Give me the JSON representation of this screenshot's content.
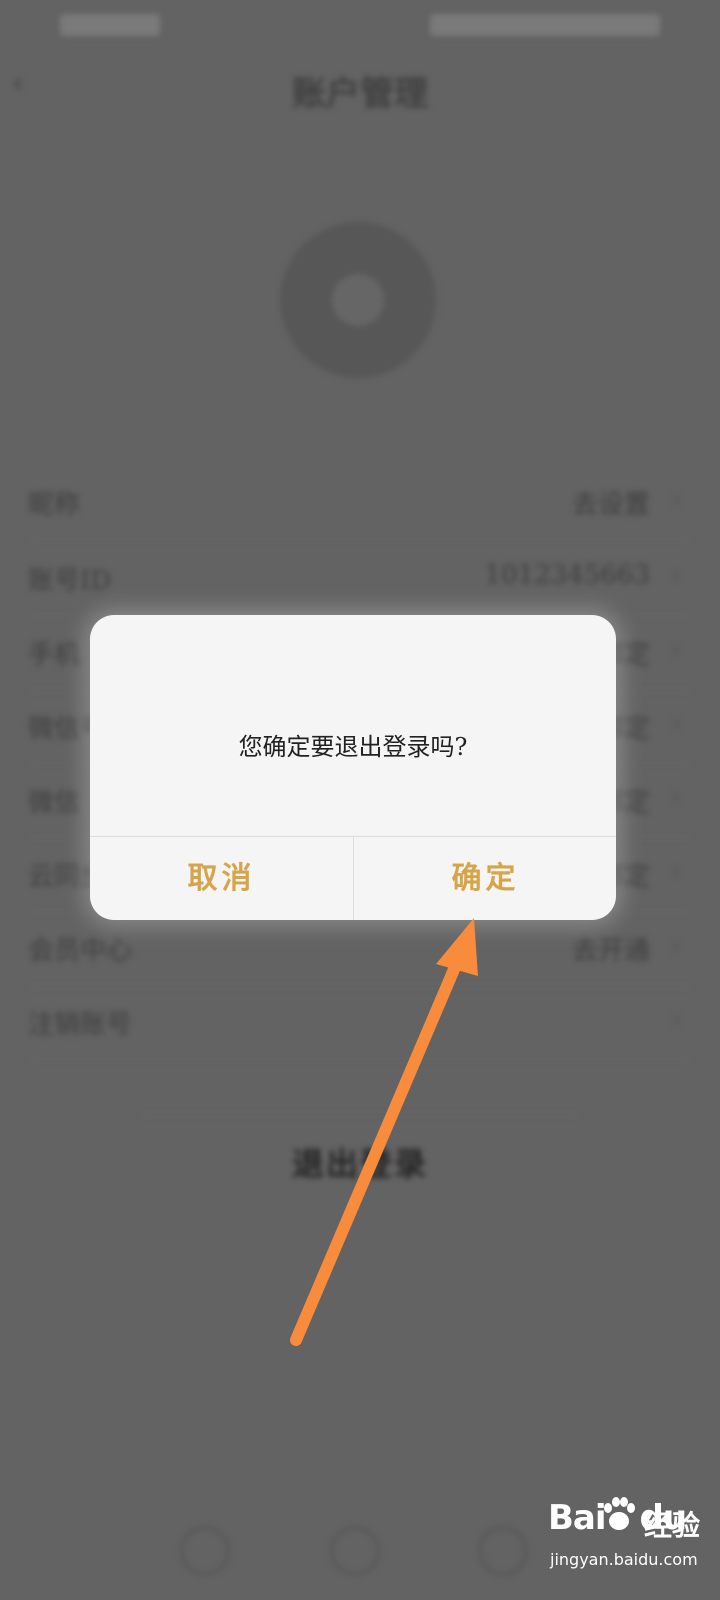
{
  "background": {
    "nav_title": "账户管理",
    "rows": [
      {
        "label": "昵称",
        "value": "去设置"
      },
      {
        "label": "账号ID",
        "value": "1012345663"
      },
      {
        "label": "手机",
        "value": "未绑定"
      },
      {
        "label": "微信号",
        "value": "未绑定"
      },
      {
        "label": "微信",
        "value": "未绑定"
      },
      {
        "label": "云同步",
        "value": "未绑定"
      },
      {
        "label": "会员中心",
        "value": "去开通"
      },
      {
        "label": "注销账号",
        "value": ""
      }
    ],
    "logout_label": "退出登录"
  },
  "dialog": {
    "message": "您确定要退出登录吗?",
    "cancel_label": "取消",
    "confirm_label": "确定"
  },
  "watermark": {
    "brand_left": "Bai",
    "brand_right": "du",
    "suffix": "经验",
    "url": "jingyan.baidu.com"
  },
  "colors": {
    "overlay": "#636363",
    "dialog_button_text": "#d6a54a",
    "annotation_arrow": "#f88b3c"
  }
}
